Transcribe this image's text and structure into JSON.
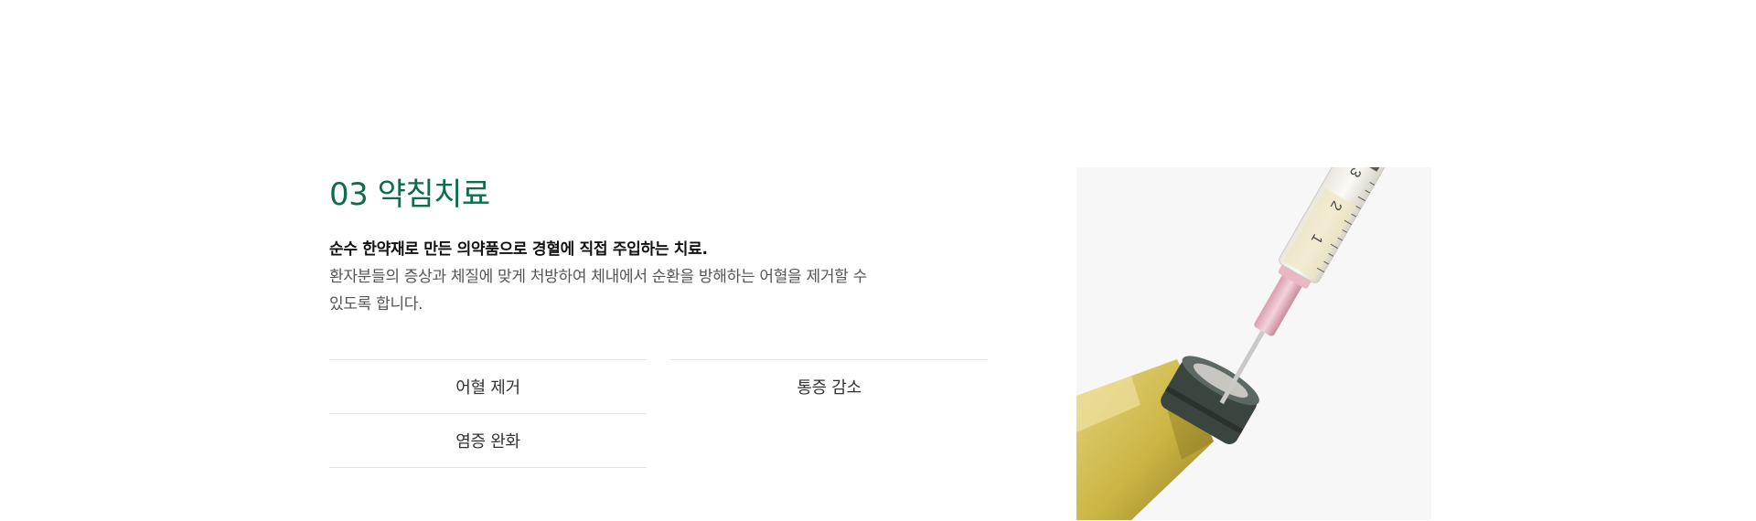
{
  "treatment": {
    "title": "03 약침치료",
    "lead": "순수 한약재로 만든 의약품으로 경혈에 직접 주입하는 치료.",
    "body": "환자분들의 증상과 체질에 맞게 처방하여  체내에서 순환을 방해하는 어혈을 제거할 수\n있도록 합니다.",
    "tags": [
      {
        "label": "어혈 제거"
      },
      {
        "label": "통증 감소"
      },
      {
        "label": "염증 완화"
      }
    ]
  },
  "image": {
    "subject": "syringe-and-vial",
    "syringe_marks": [
      "3",
      "2",
      "1"
    ],
    "colors": {
      "background": "#f7f7f7",
      "liquid": "#c9b23a",
      "cap": "#3a4540",
      "needle_hub": "#e8b9c4",
      "title_green": "#0f6b4d"
    }
  }
}
